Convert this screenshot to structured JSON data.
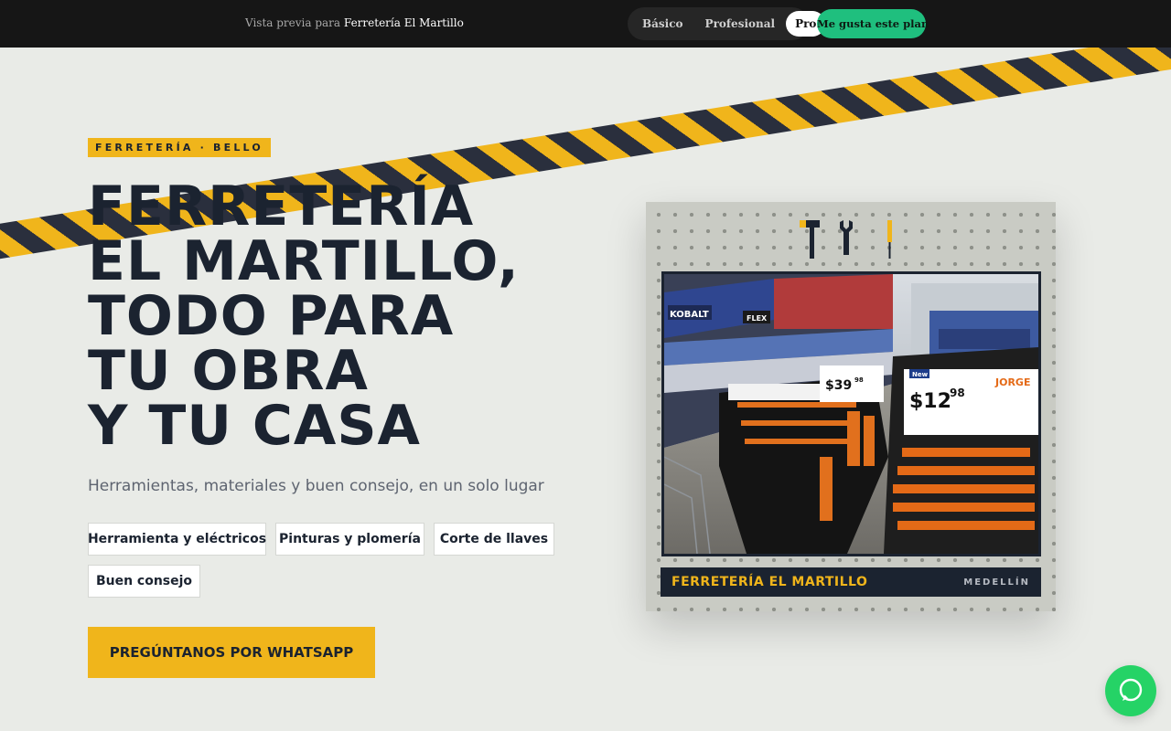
{
  "topbar": {
    "preview_prefix": "Vista previa para",
    "business_name": "Ferretería El Martillo",
    "plans": [
      "Básico",
      "Profesional",
      "Pro"
    ],
    "active_plan": "Pro",
    "like_button": "Me gusta este plan"
  },
  "hero": {
    "tag": "FERRETERÍA · BELLO",
    "headline_lines": [
      "FERRETERÍA",
      "EL MARTILLO,",
      "TODO PARA",
      "TU OBRA",
      "Y TU CASA"
    ],
    "subtitle": "Herramientas, materiales y buen consejo, en un solo lugar",
    "chips": [
      "Herramienta y eléctricos",
      "Pinturas y plomería",
      "Corte de llaves",
      "Buen consejo"
    ],
    "cta": "PREGÚNTANOS POR WHATSAPP"
  },
  "card": {
    "caption_name": "FERRETERÍA EL MARTILLO",
    "caption_city": "MEDELLÍN",
    "photo_signs": {
      "brand_1": "KOBALT",
      "brand_2": "FLEX",
      "price_main": "$12",
      "price_cents": "98",
      "price_small": "$39",
      "price_small_cents": "98",
      "brand_3": "JORGE",
      "badge": "New"
    }
  },
  "colors": {
    "accent_yellow": "#f0b51b",
    "navy": "#1b2330",
    "whatsapp_green": "#25d366",
    "like_green": "#1fbf7e"
  },
  "icons": {
    "whatsapp": "whatsapp-icon",
    "tools": [
      "hammer-icon",
      "wrench-icon",
      "screwdriver-icon"
    ]
  }
}
